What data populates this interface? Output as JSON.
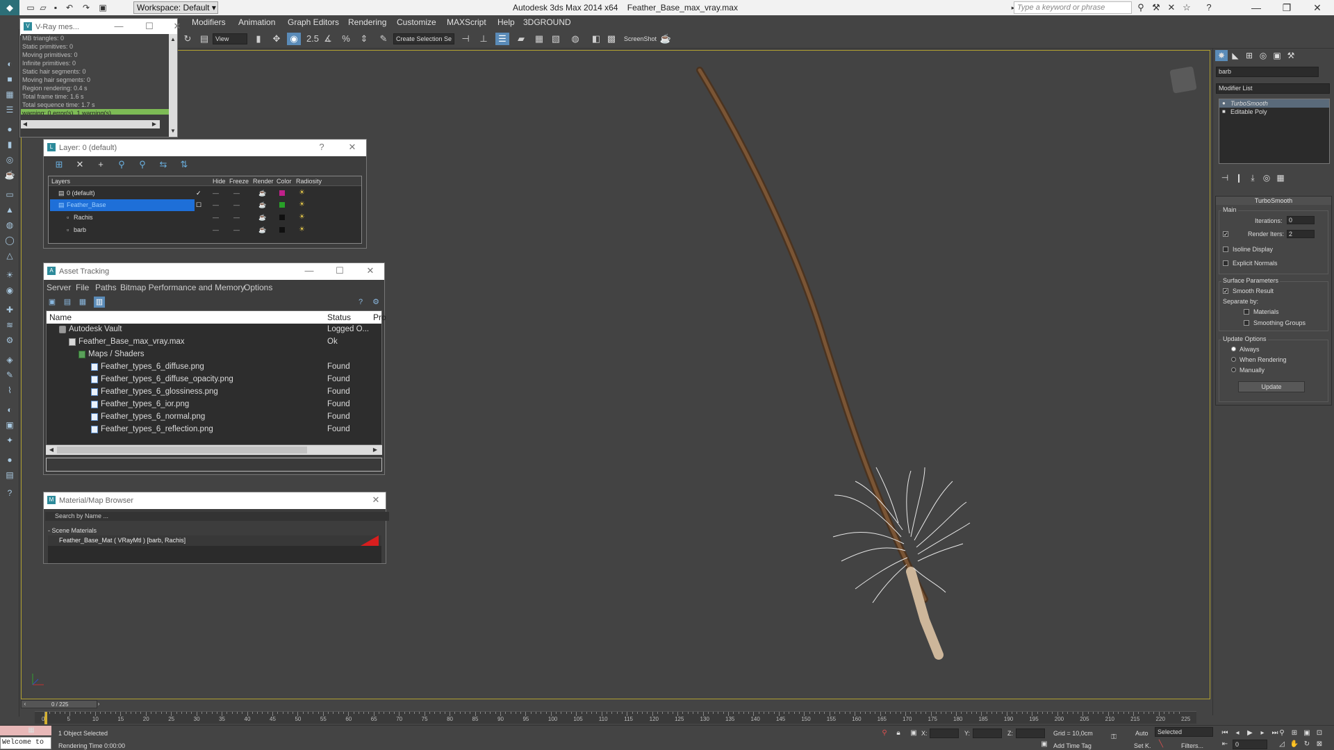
{
  "titlebar": {
    "workspace": "Workspace: Default",
    "app_title": "Autodesk 3ds Max  2014 x64",
    "file_name": "Feather_Base_max_vray.max",
    "search_placeholder": "Type a keyword or phrase"
  },
  "menu": [
    "Modifiers",
    "Animation",
    "Graph Editors",
    "Rendering",
    "Customize",
    "MAXScript",
    "Help",
    "3DGROUND"
  ],
  "toolbar": {
    "ref_coord": "View",
    "selection_set": "Create Selection Se",
    "screenshot": "ScreenShot"
  },
  "vray": {
    "title": "V-Ray mes...",
    "lines": [
      "MB triangles: 0",
      "Static primitives: 0",
      "Moving primitives: 0",
      "Infinite primitives: 0",
      "Static hair segments: 0",
      "Moving hair segments: 0",
      "Region rendering: 0.4 s",
      "Total frame time: 1.6 s",
      "Total sequence time: 1.7 s"
    ],
    "warning": "warning: 0 error(s), 1 warning(s)"
  },
  "layer": {
    "title": "Layer: 0 (default)",
    "headers": [
      "Layers",
      "Hide",
      "Freeze",
      "Render",
      "Color",
      "Radiosity"
    ],
    "rows": [
      {
        "name": "0 (default)",
        "color": "#c0208a"
      },
      {
        "name": "Feather_Base",
        "color": "#28a028"
      },
      {
        "name": "Rachis",
        "color": "#101010"
      },
      {
        "name": "barb",
        "color": "#101010"
      }
    ]
  },
  "asset": {
    "title": "Asset Tracking",
    "menu": [
      "Server",
      "File",
      "Paths",
      "Bitmap Performance and Memory",
      "Options"
    ],
    "headers": [
      "Name",
      "Status",
      "Pro"
    ],
    "rows": [
      {
        "name": "Autodesk Vault",
        "status": "Logged O..."
      },
      {
        "name": "Feather_Base_max_vray.max",
        "status": "Ok"
      },
      {
        "name": "Maps / Shaders",
        "status": ""
      },
      {
        "name": "Feather_types_6_diffuse.png",
        "status": "Found"
      },
      {
        "name": "Feather_types_6_diffuse_opacity.png",
        "status": "Found"
      },
      {
        "name": "Feather_types_6_glossiness.png",
        "status": "Found"
      },
      {
        "name": "Feather_types_6_ior.png",
        "status": "Found"
      },
      {
        "name": "Feather_types_6_normal.png",
        "status": "Found"
      },
      {
        "name": "Feather_types_6_reflection.png",
        "status": "Found"
      }
    ]
  },
  "material_browser": {
    "title": "Material/Map Browser",
    "search_placeholder": "Search by Name ...",
    "section": "- Scene Materials",
    "item": "Feather_Base_Mat ( VRayMtl ) [barb, Rachis]"
  },
  "command_panel": {
    "object_name": "barb",
    "modifier_list": "Modifier List",
    "stack": [
      "TurboSmooth",
      "Editable Poly"
    ],
    "rollout_title": "TurboSmooth",
    "main_label": "Main",
    "iterations_label": "Iterations:",
    "iterations_value": "0",
    "render_iters_label": "Render Iters:",
    "render_iters_value": "2",
    "isoline": "Isoline Display",
    "explicit_normals": "Explicit Normals",
    "surface_params": "Surface Parameters",
    "smooth_result": "Smooth Result",
    "separate_by": "Separate by:",
    "materials": "Materials",
    "smoothing_groups": "Smoothing Groups",
    "update_options": "Update Options",
    "always": "Always",
    "when_rendering": "When Rendering",
    "manually": "Manually",
    "update_button": "Update"
  },
  "timeline": {
    "frame_readout": "0 / 225",
    "ticks": [
      "0",
      "5",
      "10",
      "15",
      "20",
      "25",
      "30",
      "35",
      "40",
      "45",
      "50",
      "55",
      "60",
      "65",
      "70",
      "75",
      "80",
      "85",
      "90",
      "95",
      "100",
      "105",
      "110",
      "115",
      "120",
      "125",
      "130",
      "135",
      "140",
      "145",
      "150",
      "155",
      "160",
      "165",
      "170",
      "175",
      "180",
      "185",
      "190",
      "195",
      "200",
      "205",
      "210",
      "215",
      "220",
      "225"
    ]
  },
  "status": {
    "welcome": "Welcome to",
    "selected": "1 Object Selected",
    "rendering_time": "Rendering Time  0:00:00",
    "x_label": "X:",
    "y_label": "Y:",
    "z_label": "Z:",
    "grid": "Grid = 10,0cm",
    "add_time_tag": "Add Time Tag",
    "auto": "Auto",
    "set_k": "Set K.",
    "key_mode": "Selected",
    "filters": "Filters...",
    "frame": "0"
  }
}
